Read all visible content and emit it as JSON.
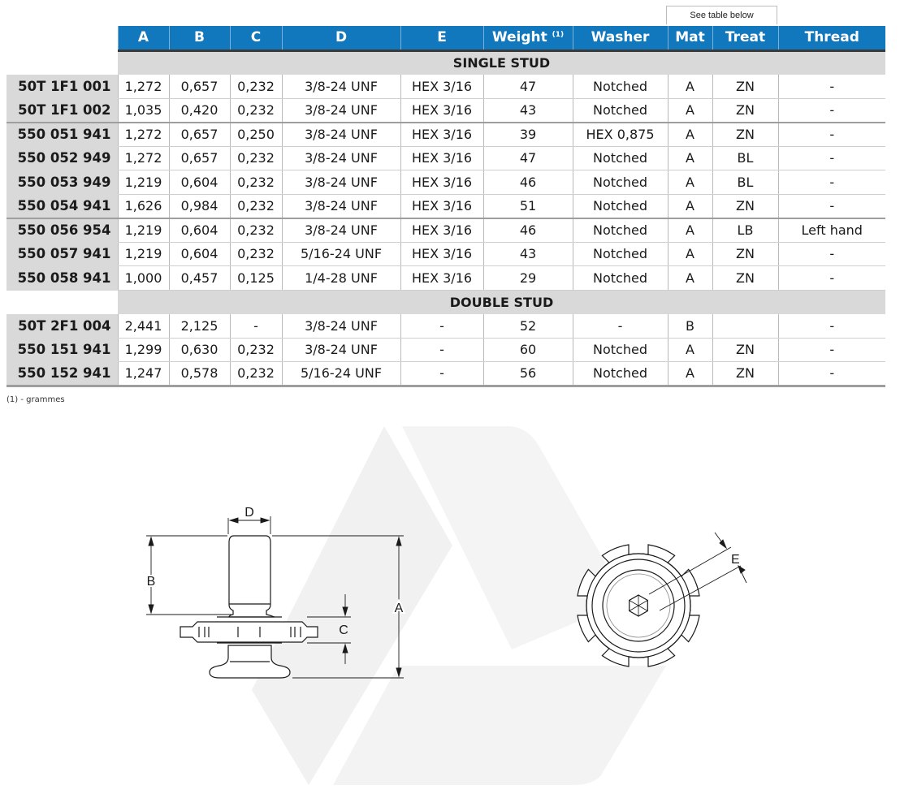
{
  "note_box": "See table below",
  "columns": {
    "a": "A",
    "b": "B",
    "c": "C",
    "d": "D",
    "e": "E",
    "weight": "Weight",
    "weight_note": "(1)",
    "washer": "Washer",
    "mat": "Mat",
    "treat": "Treat",
    "thread": "Thread"
  },
  "groups": {
    "single": {
      "title": "SINGLE STUD",
      "rows": [
        {
          "ref": "50T 1F1 001",
          "a": "1,272",
          "b": "0,657",
          "c": "0,232",
          "d": "3/8-24 UNF",
          "e": "HEX 3/16",
          "weight": "47",
          "washer": "Notched",
          "mat": "A",
          "treat": "ZN",
          "thread": "-"
        },
        {
          "ref": "50T 1F1 002",
          "a": "1,035",
          "b": "0,420",
          "c": "0,232",
          "d": "3/8-24 UNF",
          "e": "HEX 3/16",
          "weight": "43",
          "washer": "Notched",
          "mat": "A",
          "treat": "ZN",
          "thread": "-"
        },
        {
          "ref": "550 051 941",
          "a": "1,272",
          "b": "0,657",
          "c": "0,250",
          "d": "3/8-24 UNF",
          "e": "HEX 3/16",
          "weight": "39",
          "washer": "HEX 0,875",
          "mat": "A",
          "treat": "ZN",
          "thread": "-"
        },
        {
          "ref": "550 052 949",
          "a": "1,272",
          "b": "0,657",
          "c": "0,232",
          "d": "3/8-24 UNF",
          "e": "HEX 3/16",
          "weight": "47",
          "washer": "Notched",
          "mat": "A",
          "treat": "BL",
          "thread": "-"
        },
        {
          "ref": "550 053 949",
          "a": "1,219",
          "b": "0,604",
          "c": "0,232",
          "d": "3/8-24 UNF",
          "e": "HEX 3/16",
          "weight": "46",
          "washer": "Notched",
          "mat": "A",
          "treat": "BL",
          "thread": "-"
        },
        {
          "ref": "550 054 941",
          "a": "1,626",
          "b": "0,984",
          "c": "0,232",
          "d": "3/8-24 UNF",
          "e": "HEX 3/16",
          "weight": "51",
          "washer": "Notched",
          "mat": "A",
          "treat": "ZN",
          "thread": "-"
        },
        {
          "ref": "550 056 954",
          "a": "1,219",
          "b": "0,604",
          "c": "0,232",
          "d": "3/8-24 UNF",
          "e": "HEX 3/16",
          "weight": "46",
          "washer": "Notched",
          "mat": "A",
          "treat": "LB",
          "thread": "Left hand"
        },
        {
          "ref": "550 057 941",
          "a": "1,219",
          "b": "0,604",
          "c": "0,232",
          "d": "5/16-24 UNF",
          "e": "HEX 3/16",
          "weight": "43",
          "washer": "Notched",
          "mat": "A",
          "treat": "ZN",
          "thread": "-"
        },
        {
          "ref": "550 058 941",
          "a": "1,000",
          "b": "0,457",
          "c": "0,125",
          "d": "1/4-28 UNF",
          "e": "HEX 3/16",
          "weight": "29",
          "washer": "Notched",
          "mat": "A",
          "treat": "ZN",
          "thread": "-"
        }
      ]
    },
    "double": {
      "title": "DOUBLE STUD",
      "rows": [
        {
          "ref": "50T 2F1 004",
          "a": "2,441",
          "b": "2,125",
          "c": "-",
          "d": "3/8-24 UNF",
          "e": "-",
          "weight": "52",
          "washer": "-",
          "mat": "B",
          "treat": "",
          "thread": "-"
        },
        {
          "ref": "550 151 941",
          "a": "1,299",
          "b": "0,630",
          "c": "0,232",
          "d": "3/8-24 UNF",
          "e": "-",
          "weight": "60",
          "washer": "Notched",
          "mat": "A",
          "treat": "ZN",
          "thread": "-"
        },
        {
          "ref": "550 152 941",
          "a": "1,247",
          "b": "0,578",
          "c": "0,232",
          "d": "5/16-24 UNF",
          "e": "-",
          "weight": "56",
          "washer": "Notched",
          "mat": "A",
          "treat": "ZN",
          "thread": "-"
        }
      ]
    }
  },
  "footnote": "(1) - grammes",
  "drawing": {
    "side_view_labels": {
      "a": "A",
      "b": "B",
      "c": "C",
      "d": "D"
    },
    "top_view_labels": {
      "e": "E"
    },
    "line_color": "#1a1a1a",
    "watermark_color": "#eeeeee"
  }
}
